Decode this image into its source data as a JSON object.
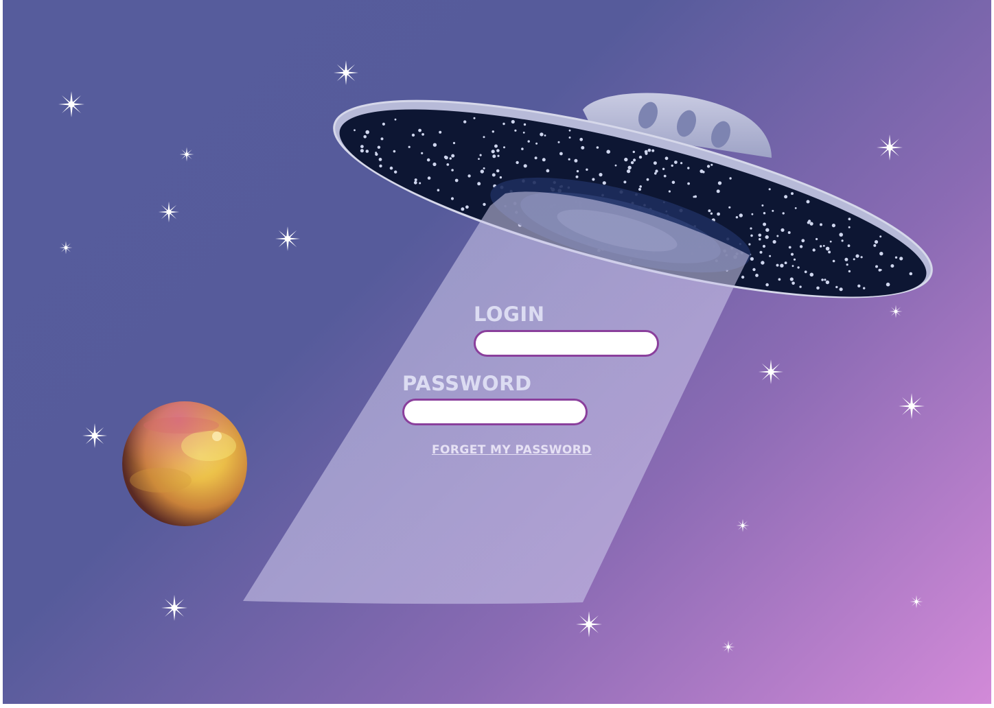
{
  "form": {
    "login_label": "LOGIN",
    "login_value": "",
    "password_label": "PASSWORD",
    "password_value": "",
    "forgot_link": "FORGET MY PASSWORD"
  },
  "colors": {
    "background_start": "#565c9c",
    "background_end": "#d28ad8",
    "label_text": "#dcdcf2",
    "input_border": "#8a3f9c",
    "input_fill": "#ffffff",
    "beam": "#c8c3e6",
    "saucer_hull": "#b9bcd6",
    "saucer_underside": "#0d1633",
    "planet": "#e6b64a"
  },
  "icons": {
    "ufo": "ufo-icon",
    "planet": "planet-icon",
    "star": "star-icon",
    "beam": "light-beam"
  }
}
